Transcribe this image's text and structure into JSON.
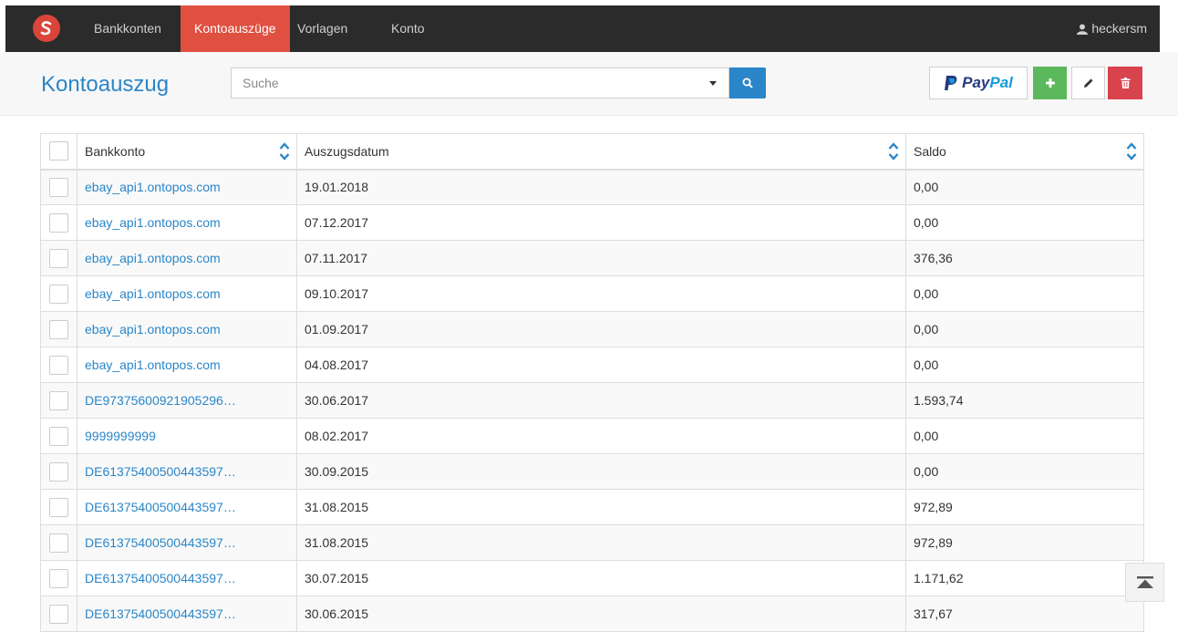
{
  "nav": {
    "items": [
      {
        "label": "Bankkonten",
        "active": false
      },
      {
        "label": "Kontoauszüge",
        "active": true
      },
      {
        "label": "Vorlagen",
        "active": false
      },
      {
        "label": "Konto",
        "active": false
      }
    ],
    "user": "heckersm"
  },
  "header": {
    "title": "Kontoauszug",
    "search_placeholder": "Suche",
    "paypal_label_1": "Pay",
    "paypal_label_2": "Pal"
  },
  "table": {
    "columns": [
      "Bankkonto",
      "Auszugsdatum",
      "Saldo"
    ],
    "rows": [
      {
        "account": "ebay_api1.ontopos.com",
        "date": "19.01.2018",
        "balance": "0,00"
      },
      {
        "account": "ebay_api1.ontopos.com",
        "date": "07.12.2017",
        "balance": "0,00"
      },
      {
        "account": "ebay_api1.ontopos.com",
        "date": "07.11.2017",
        "balance": "376,36"
      },
      {
        "account": "ebay_api1.ontopos.com",
        "date": "09.10.2017",
        "balance": "0,00"
      },
      {
        "account": "ebay_api1.ontopos.com",
        "date": "01.09.2017",
        "balance": "0,00"
      },
      {
        "account": "ebay_api1.ontopos.com",
        "date": "04.08.2017",
        "balance": "0,00"
      },
      {
        "account": "DE97375600921905296…",
        "date": "30.06.2017",
        "balance": "1.593,74"
      },
      {
        "account": "9999999999",
        "date": "08.02.2017",
        "balance": "0,00"
      },
      {
        "account": "DE61375400500443597…",
        "date": "30.09.2015",
        "balance": "0,00"
      },
      {
        "account": "DE61375400500443597…",
        "date": "31.08.2015",
        "balance": "972,89"
      },
      {
        "account": "DE61375400500443597…",
        "date": "31.08.2015",
        "balance": "972,89"
      },
      {
        "account": "DE61375400500443597…",
        "date": "30.07.2015",
        "balance": "1.171,62"
      },
      {
        "account": "DE61375400500443597…",
        "date": "30.06.2015",
        "balance": "317,67"
      }
    ]
  },
  "colors": {
    "navbar": "#2b2b2b",
    "nav_active": "#e05040",
    "primary": "#2a86c8",
    "success": "#5cb85c",
    "danger": "#d9434e"
  },
  "icons": [
    "logo-icon",
    "user-icon",
    "caret-down-icon",
    "search-icon",
    "paypal-icon",
    "plus-icon",
    "pencil-icon",
    "trash-icon",
    "sort-icon",
    "scroll-top-icon"
  ]
}
